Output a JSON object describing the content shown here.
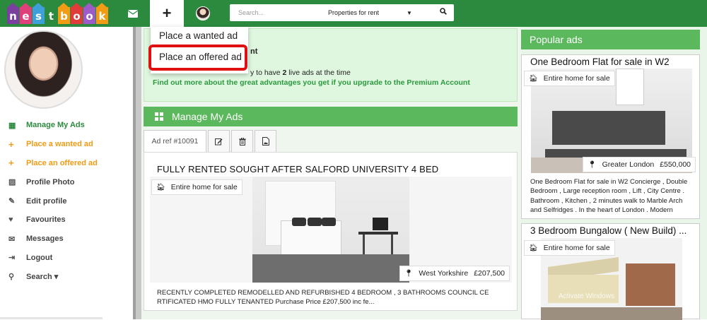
{
  "header": {
    "logo_letters": [
      "n",
      "e",
      "s",
      "t",
      "b",
      "o",
      "o",
      "k"
    ],
    "logo_colors": [
      "#7b3fa0",
      "#e0407a",
      "#3da0d8",
      "#2b8a3e",
      "#f29b14",
      "#e03c3c",
      "#9c5bc7",
      "#f29b14"
    ],
    "search_placeholder": "Search...",
    "search_category": "Properties for rent",
    "caret": "▼",
    "plus_label": "+"
  },
  "dropdown": {
    "items": [
      "Place a wanted ad",
      "Place an offered ad"
    ]
  },
  "sidebar": {
    "items": [
      {
        "label": "Manage My Ads",
        "icon": "grid-icon",
        "glyph": "▦"
      },
      {
        "label": "Place a wanted ad",
        "icon": "plus-icon",
        "glyph": "+"
      },
      {
        "label": "Place an offered ad",
        "icon": "plus-icon",
        "glyph": "+"
      },
      {
        "label": "Profile Photo",
        "icon": "image-icon",
        "glyph": "▨"
      },
      {
        "label": "Edit profile",
        "icon": "edit-icon",
        "glyph": "✎"
      },
      {
        "label": "Favourites",
        "icon": "heart-icon",
        "glyph": "♥"
      },
      {
        "label": "Messages",
        "icon": "envelope-icon",
        "glyph": "✉"
      },
      {
        "label": "Logout",
        "icon": "logout-icon",
        "glyph": "⇥"
      },
      {
        "label": "Search ▾",
        "icon": "search-icon",
        "glyph": "⚲"
      }
    ]
  },
  "info": {
    "title_fragment": "nt",
    "line_pre": "y to have ",
    "line_num": "2",
    "line_post": " live ads at the time",
    "upgrade_link": "Find out more about the great advantages you get if you upgrade to the Premium Account"
  },
  "manage": {
    "header": "Manage My Ads",
    "tab_ref": "Ad ref #10091"
  },
  "ad": {
    "title": "FULLY RENTED SOUGHT AFTER SALFORD UNIVERSITY 4 BED",
    "badge_type": "Entire home for sale",
    "location": "West Yorkshire",
    "price": "£207,500",
    "description": "RECENTLY COMPLETED REMODELLED AND REFURBISHED 4 BEDROOM , 3 BATHROOMS COUNCIL CE RTIFICATED HMO FULLY TENANTED Purchase Price £207,500 inc fe..."
  },
  "popular": {
    "header": "Popular ads",
    "cards": [
      {
        "title": "One Bedroom Flat for sale in W2",
        "badge_type": "Entire home for sale",
        "location": "Greater London",
        "price": "£550,000",
        "description": "One Bedroom Flat for sale in W2 Concierge , Double Bedroom , Large reception room , Lift , City Centre . Bathroom , Kitchen , 2 minutes walk to Marble Arch and Selfridges . In the heart of London . Modern"
      },
      {
        "title": "3 Bedroom Bungalow ( New Build) ...",
        "badge_type": "Entire home for sale"
      }
    ]
  },
  "watermark": "Activate Windows"
}
